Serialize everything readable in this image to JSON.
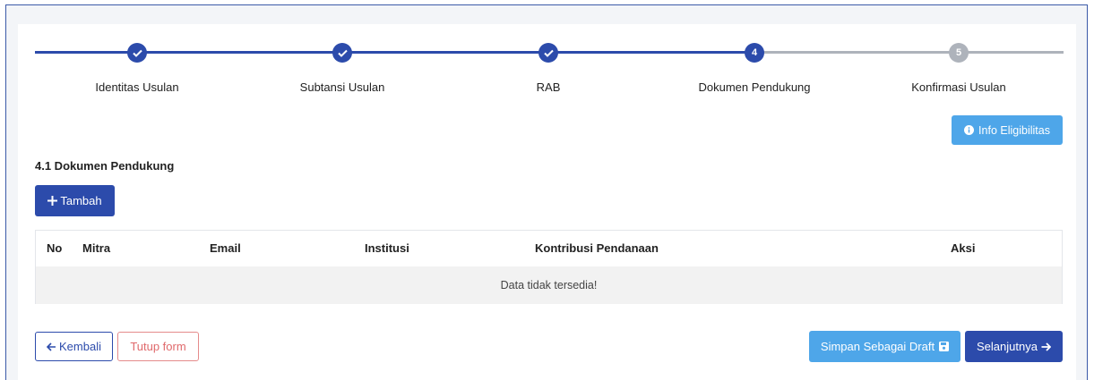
{
  "stepper": {
    "steps": [
      {
        "label": "Identitas Usulan",
        "status": "done",
        "number": ""
      },
      {
        "label": "Subtansi Usulan",
        "status": "done",
        "number": ""
      },
      {
        "label": "RAB",
        "status": "done",
        "number": ""
      },
      {
        "label": "Dokumen Pendukung",
        "status": "active",
        "number": "4"
      },
      {
        "label": "Konfirmasi Usulan",
        "status": "todo",
        "number": "5"
      }
    ]
  },
  "info_button": {
    "label": "Info Eligibilitas",
    "icon": "info-circle-icon"
  },
  "section": {
    "title": "4.1 Dokumen Pendukung"
  },
  "add_button": {
    "label": "Tambah",
    "icon": "plus-icon"
  },
  "table": {
    "columns": [
      "No",
      "Mitra",
      "Email",
      "Institusi",
      "Kontribusi Pendanaan",
      "Aksi"
    ],
    "empty_message": "Data tidak tersedia!"
  },
  "footer": {
    "back_label": "Kembali",
    "close_label": "Tutup form",
    "draft_label": "Simpan Sebagai Draft",
    "next_label": "Selanjutnya"
  },
  "colors": {
    "primary": "#2c4bab",
    "info": "#4ea6e9",
    "danger": "#e0696b",
    "inactive": "#aeb3bb"
  }
}
